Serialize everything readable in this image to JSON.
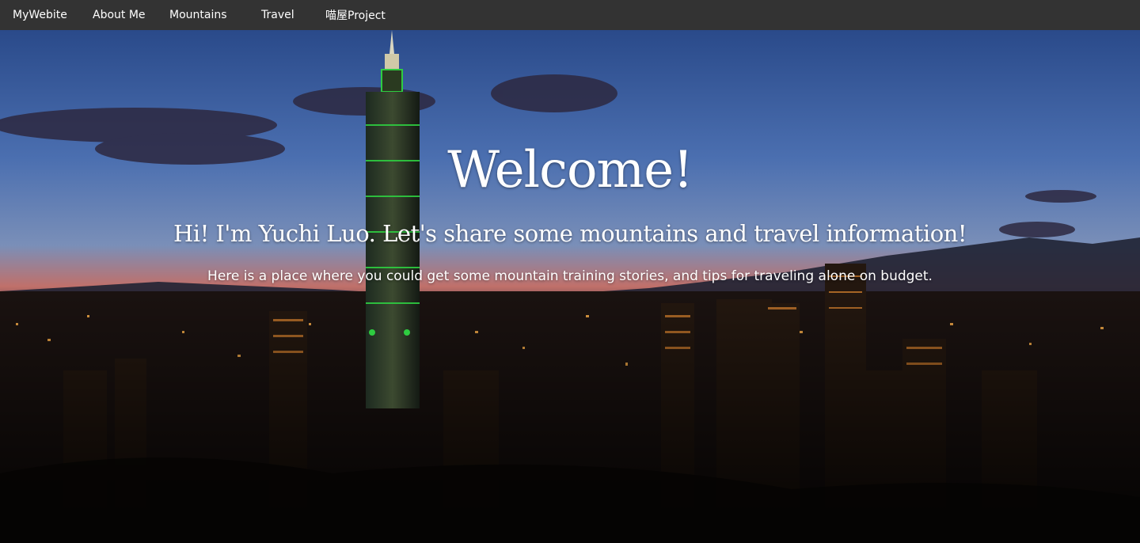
{
  "nav": {
    "brand": "MyWebite",
    "items": [
      {
        "label": "About Me"
      },
      {
        "label": "Mountains"
      },
      {
        "label": "Travel"
      },
      {
        "label": "喵屋Project"
      }
    ]
  },
  "hero": {
    "title": "Welcome!",
    "subtitle": "Hi! I'm Yuchi Luo. Let's share some mountains and travel information!",
    "description": "Here is a place where you could get some mountain training stories, and tips for traveling alone on budget.",
    "background_image": "night-city-skyline-photo"
  },
  "colors": {
    "navbar_bg": "#333333",
    "nav_text": "#ffffff",
    "hero_text": "#ffffff",
    "sky_top": "#2a4a8a",
    "sky_horizon": "#c0706a"
  }
}
